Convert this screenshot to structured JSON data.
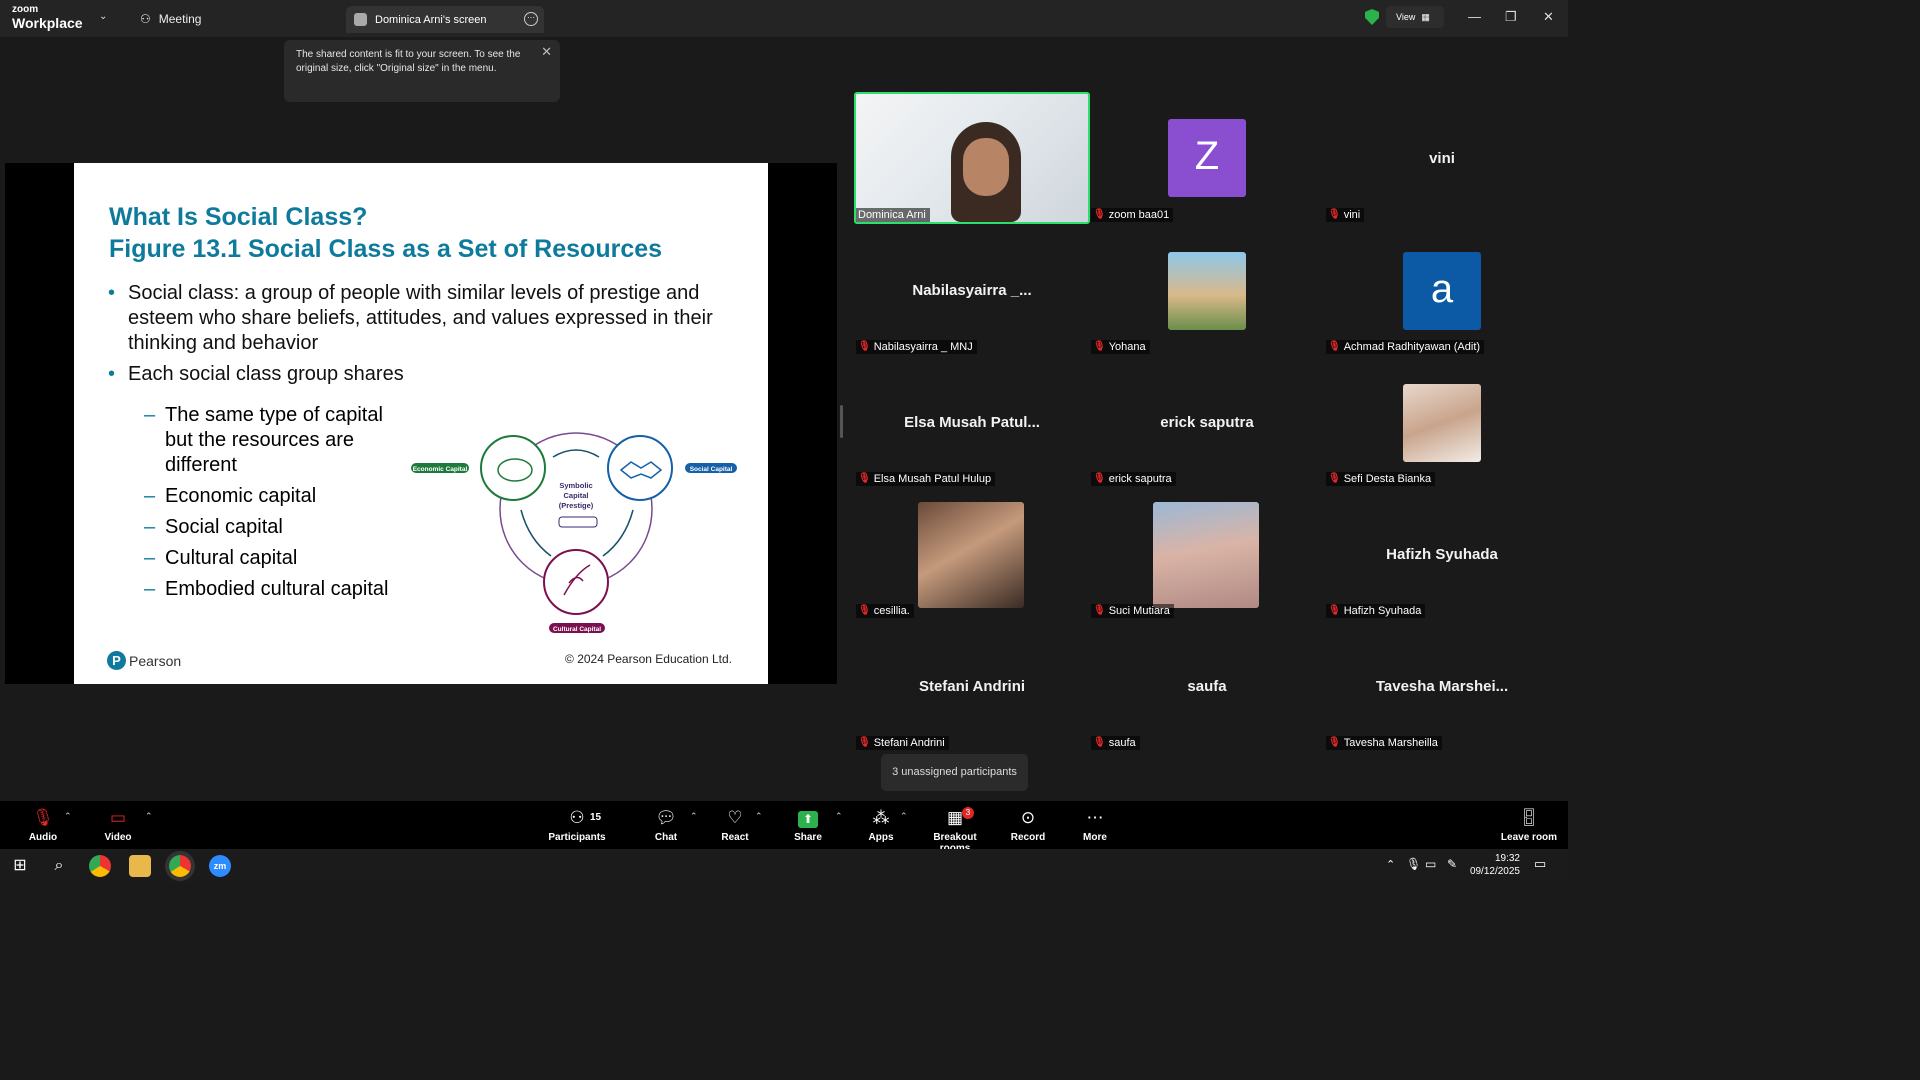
{
  "app": {
    "brand_top": "zoom",
    "brand_bottom": "Workplace",
    "meeting_label": "Meeting"
  },
  "screen_tab": {
    "label": "Dominica Arni's screen"
  },
  "view_button": {
    "label": "View"
  },
  "tooltip": {
    "text": "The shared content is fit to your screen. To see the original size, click \"Original size\" in the menu."
  },
  "slide": {
    "title_line1": "What Is Social Class?",
    "title_line2": "Figure 13.1 Social Class as a Set of Resources",
    "bullets": [
      "Social class: a group of people with similar levels of prestige and esteem who share beliefs, attitudes, and values expressed in their thinking and behavior",
      "Each social class group shares"
    ],
    "sub_bullets": [
      "The same type of capital but the resources are different",
      "Economic capital",
      "Social capital",
      "Cultural capital",
      "Embodied cultural capital"
    ],
    "diagram": {
      "economic": "Economic Capital",
      "social": "Social Capital",
      "cultural": "Cultural Capital",
      "symbolic_1": "Symbolic",
      "symbolic_2": "Capital",
      "symbolic_3": "(Prestige)"
    },
    "publisher": "Pearson",
    "copyright": "© 2024 Pearson Education Ltd."
  },
  "participants": [
    {
      "label": "Dominica Arni"
    },
    {
      "label": "zoom baa01",
      "initial": "Z"
    },
    {
      "label": "vini",
      "display": "vini"
    },
    {
      "label": "Nabilasyairra _ MNJ",
      "display": "Nabilasyairra _..."
    },
    {
      "label": "Yohana"
    },
    {
      "label": "Achmad Radhityawan (Adit)",
      "initial": "a"
    },
    {
      "label": "Elsa Musah Patul Hulup",
      "display": "Elsa Musah Patul..."
    },
    {
      "label": "erick saputra",
      "display": "erick saputra"
    },
    {
      "label": "Sefi Desta Bianka"
    },
    {
      "label": "cesillia."
    },
    {
      "label": "Suci Mutiara"
    },
    {
      "label": "Hafizh Syuhada",
      "display": "Hafizh Syuhada"
    },
    {
      "label": "Stefani Andrini",
      "display": "Stefani Andrini"
    },
    {
      "label": "saufa",
      "display": "saufa"
    },
    {
      "label": "Tavesha Marsheilla",
      "display": "Tavesha Marshei..."
    }
  ],
  "toast": {
    "text": "3 unassigned participants"
  },
  "toolbar": {
    "audio": "Audio",
    "video": "Video",
    "participants": "Participants",
    "participant_count": "15",
    "chat": "Chat",
    "react": "React",
    "share": "Share",
    "apps": "Apps",
    "breakout": "Breakout rooms",
    "breakout_badge": "3",
    "record": "Record",
    "more": "More",
    "leave": "Leave room"
  },
  "taskbar": {
    "time": "19:32",
    "date": "09/12/2025"
  },
  "colors": {
    "accent": "#0e7a9c",
    "active_speaker": "#2ee06b",
    "mic_off": "#e02828",
    "economic": "#1e7a3c",
    "social": "#1560a8",
    "cultural": "#7a1050"
  }
}
